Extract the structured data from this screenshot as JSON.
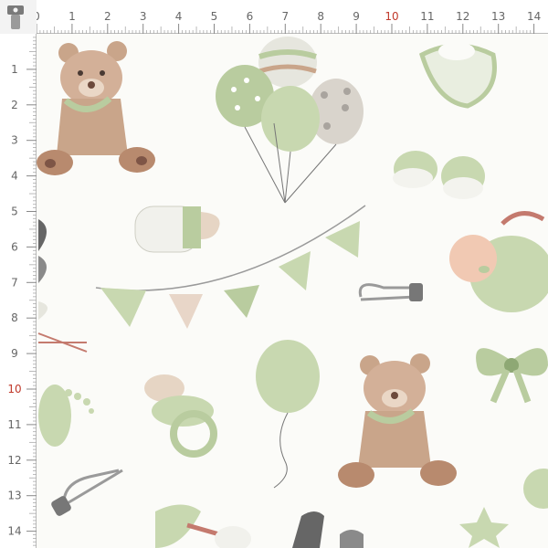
{
  "ruler": {
    "unit": "cm",
    "top_labels": [
      "0",
      "1",
      "2",
      "3",
      "4",
      "5",
      "6",
      "7",
      "8",
      "9",
      "10",
      "11",
      "12",
      "13",
      "14"
    ],
    "left_labels": [
      "1",
      "2",
      "3",
      "4",
      "5",
      "6",
      "7",
      "8",
      "9",
      "10",
      "11",
      "12",
      "13",
      "14"
    ],
    "highlight_label": "10",
    "label_color": "#666666",
    "highlight_color": "#c0392b"
  },
  "pattern": {
    "background": "#fbfbf8",
    "palette": {
      "sage": "#b9cc9f",
      "sage_dark": "#8ea874",
      "bear": "#c9a58a",
      "bear_dark": "#a77f66",
      "grey": "#9a9a9a",
      "skin": "#f1c9b3"
    },
    "motifs": [
      "teddy-bear",
      "balloon-bunch",
      "bunting-garland",
      "baby-bottle",
      "baby-shoes",
      "bib",
      "swaddled-baby",
      "safety-pin",
      "bow",
      "pacifier",
      "single-balloon",
      "footprint",
      "star",
      "stork"
    ]
  }
}
